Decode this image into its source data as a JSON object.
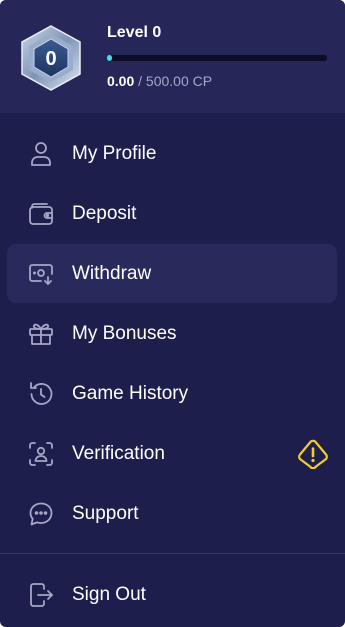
{
  "profile": {
    "level_badge_number": "0",
    "level_title": "Level 0",
    "current_points": "0.00",
    "separator": " / ",
    "max_points": "500.00 CP",
    "progress_fraction": 0.0
  },
  "menu": {
    "items": [
      {
        "label": "My Profile",
        "icon": "user-icon"
      },
      {
        "label": "Deposit",
        "icon": "wallet-icon"
      },
      {
        "label": "Withdraw",
        "icon": "cash-withdraw-icon",
        "active": true
      },
      {
        "label": "My Bonuses",
        "icon": "gift-icon"
      },
      {
        "label": "Game History",
        "icon": "history-icon"
      },
      {
        "label": "Verification",
        "icon": "id-scan-icon",
        "warning_icon": "warning-icon"
      },
      {
        "label": "Support",
        "icon": "chat-icon"
      }
    ],
    "sign_out": {
      "label": "Sign Out",
      "icon": "sign-out-icon"
    }
  },
  "colors": {
    "panel_bg": "#1e1e4c",
    "header_bg": "#262659",
    "active_item_bg": "#292a5c",
    "progress_accent": "#4ad7ea",
    "icon_stroke": "#a5a7c6",
    "warning_yellow": "#f2cd2a"
  }
}
